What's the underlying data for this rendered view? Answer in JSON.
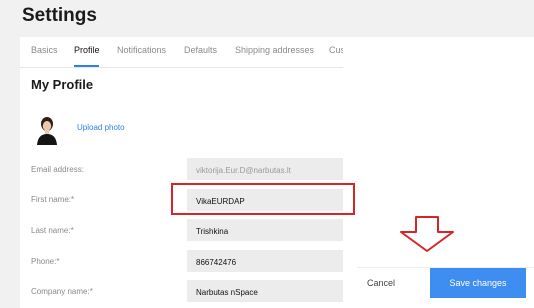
{
  "page": {
    "title": "Settings"
  },
  "tabs": [
    {
      "label": "Basics"
    },
    {
      "label": "Profile"
    },
    {
      "label": "Notifications"
    },
    {
      "label": "Defaults"
    },
    {
      "label": "Shipping addresses"
    },
    {
      "label": "Customers"
    }
  ],
  "active_tab": "Profile",
  "profile": {
    "section_title": "My Profile",
    "upload_label": "Upload photo",
    "fields": [
      {
        "label": "Email address:",
        "value": "viktorija.Eur.D@narbutas.lt",
        "disabled": true
      },
      {
        "label": "First name:*",
        "value": "VikaEURDAP"
      },
      {
        "label": "Last name:*",
        "value": "Trishkina"
      },
      {
        "label": "Phone:*",
        "value": "866742476"
      },
      {
        "label": "Company name:*",
        "value": "Narbutas nSpace"
      }
    ]
  },
  "footer": {
    "cancel_label": "Cancel",
    "save_label": "Save changes"
  },
  "colors": {
    "accent": "#3d8ef0",
    "highlight": "#d6262a"
  }
}
